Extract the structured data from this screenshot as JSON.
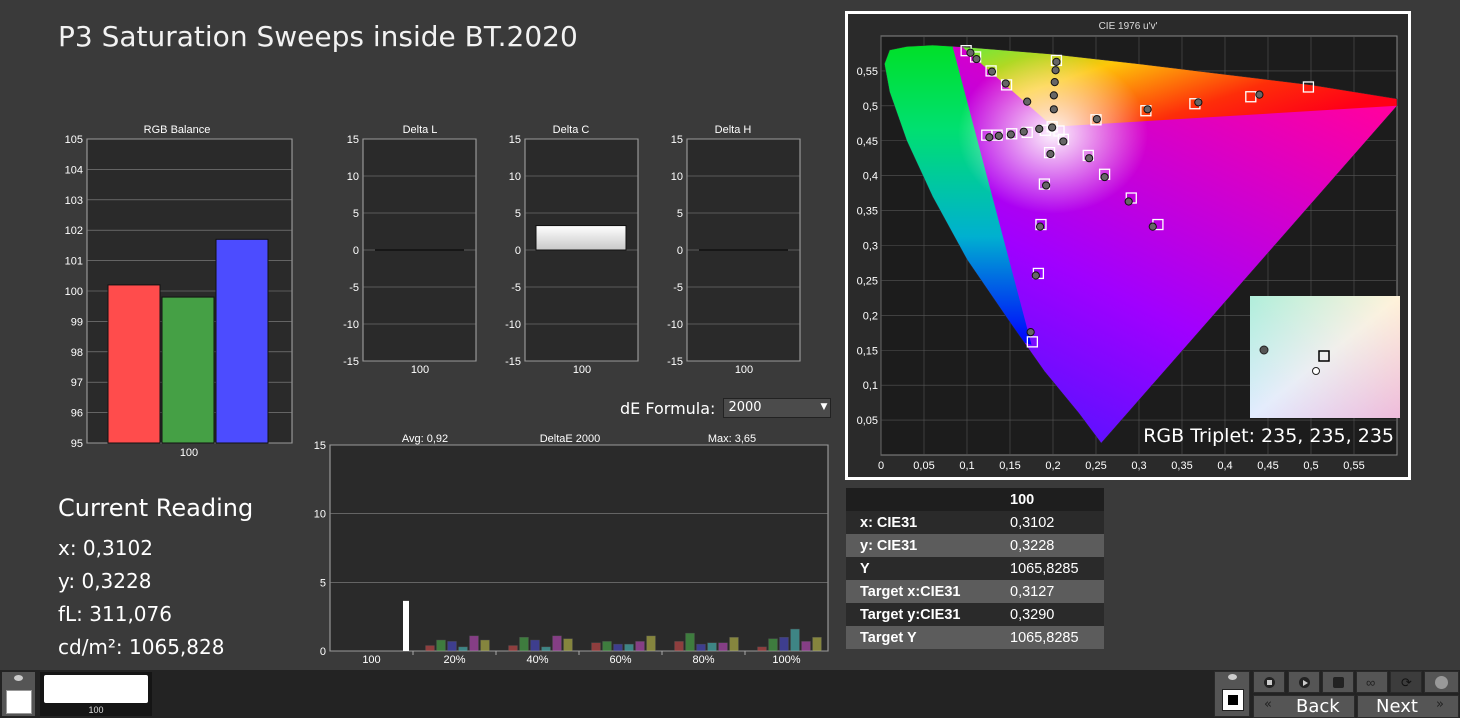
{
  "title": "P3 Saturation Sweeps inside BT.2020",
  "current_reading": {
    "heading": "Current Reading",
    "x": "x: 0,3102",
    "y": "y: 0,3228",
    "fl": "fL: 311,076",
    "cdm2": "cd/m²: 1065,828"
  },
  "formula": {
    "label": "dE Formula:",
    "value": "2000"
  },
  "rgb_triplet": "RGB Triplet: 235, 235, 235",
  "table": {
    "header": "100",
    "rows": [
      {
        "label": "x: CIE31",
        "value": "0,3102"
      },
      {
        "label": "y: CIE31",
        "value": "0,3228"
      },
      {
        "label": "Y",
        "value": "1065,8285"
      },
      {
        "label": "Target x:CIE31",
        "value": "0,3127"
      },
      {
        "label": "Target y:CIE31",
        "value": "0,3290"
      },
      {
        "label": "Target Y",
        "value": "1065,8285"
      }
    ]
  },
  "thumbnail_label": "100",
  "nav": {
    "back": "Back",
    "next": "Next"
  },
  "chart_data": [
    {
      "type": "bar",
      "title": "RGB Balance",
      "categories": [
        "100"
      ],
      "series": [
        {
          "color": "#ff4c4c",
          "values": [
            100.2
          ]
        },
        {
          "color": "#45a045",
          "values": [
            99.8
          ]
        },
        {
          "color": "#4c4cff",
          "values": [
            101.7
          ]
        }
      ],
      "ylim": [
        95,
        105
      ],
      "yticks": [
        "105",
        "104",
        "103",
        "102",
        "101",
        "100",
        "99",
        "98",
        "97",
        "96",
        "95"
      ],
      "grid": true
    },
    {
      "type": "bar",
      "title": "Delta L",
      "categories": [
        "100"
      ],
      "values": [
        0
      ],
      "ylim": [
        -15,
        15
      ],
      "yticks": [
        "15",
        "10",
        "5",
        "0",
        "-5",
        "-10",
        "-15"
      ]
    },
    {
      "type": "bar",
      "title": "Delta C",
      "categories": [
        "100"
      ],
      "values": [
        3.3
      ],
      "ylim": [
        -15,
        15
      ],
      "yticks": [
        "15",
        "10",
        "5",
        "0",
        "-5",
        "-10",
        "-15"
      ]
    },
    {
      "type": "bar",
      "title": "Delta H",
      "categories": [
        "100"
      ],
      "values": [
        0
      ],
      "ylim": [
        -15,
        15
      ],
      "yticks": [
        "15",
        "10",
        "5",
        "0",
        "-5",
        "-10",
        "-15"
      ]
    },
    {
      "type": "bar",
      "title": "DeltaE 2000",
      "avg_label": "Avg: 0,92",
      "max_label": "Max: 3,65",
      "categories": [
        "100",
        "20%",
        "40%",
        "60%",
        "80%",
        "100%"
      ],
      "series_colors": [
        "#e05050",
        "#50c050",
        "#5050e0",
        "#50d0d0",
        "#d050d0",
        "#d0d050"
      ],
      "groups": [
        [
          3.65
        ],
        [
          0.4,
          0.8,
          0.7,
          0.3,
          1.1,
          0.8
        ],
        [
          0.4,
          1.0,
          0.8,
          0.3,
          1.1,
          0.9
        ],
        [
          0.6,
          0.7,
          0.5,
          0.5,
          0.7,
          1.1
        ],
        [
          0.7,
          1.3,
          0.5,
          0.6,
          0.6,
          1.0
        ],
        [
          0.3,
          0.9,
          1.0,
          1.6,
          0.7,
          1.0
        ]
      ],
      "ylim": [
        0,
        15
      ],
      "yticks": [
        "15",
        "10",
        "5",
        "0"
      ]
    },
    {
      "type": "scatter",
      "title": "CIE 1976 u'v'",
      "xlim": [
        0,
        0.6
      ],
      "ylim": [
        0,
        0.6
      ],
      "xticks": [
        "0",
        "0,05",
        "0,1",
        "0,15",
        "0,2",
        "0,25",
        "0,3",
        "0,35",
        "0,4",
        "0,45",
        "0,5",
        "0,55"
      ],
      "yticks": [
        "0,55",
        "0,5",
        "0,45",
        "0,4",
        "0,35",
        "0,3",
        "0,25",
        "0,2",
        "0,15",
        "0,1",
        "0,05"
      ],
      "targets": [
        [
          0.099,
          0.579
        ],
        [
          0.11,
          0.57
        ],
        [
          0.128,
          0.55
        ],
        [
          0.146,
          0.53
        ],
        [
          0.204,
          0.565
        ],
        [
          0.123,
          0.458
        ],
        [
          0.135,
          0.458
        ],
        [
          0.152,
          0.46
        ],
        [
          0.17,
          0.462
        ],
        [
          0.191,
          0.465
        ],
        [
          0.207,
          0.464
        ],
        [
          0.212,
          0.452
        ],
        [
          0.196,
          0.433
        ],
        [
          0.19,
          0.388
        ],
        [
          0.186,
          0.33
        ],
        [
          0.183,
          0.26
        ],
        [
          0.176,
          0.162
        ],
        [
          0.241,
          0.429
        ],
        [
          0.26,
          0.402
        ],
        [
          0.291,
          0.368
        ],
        [
          0.322,
          0.33
        ],
        [
          0.25,
          0.48
        ],
        [
          0.308,
          0.493
        ],
        [
          0.365,
          0.503
        ],
        [
          0.43,
          0.513
        ],
        [
          0.497,
          0.527
        ],
        [
          0.199,
          0.47
        ]
      ],
      "measured": [
        [
          0.104,
          0.576
        ],
        [
          0.111,
          0.567
        ],
        [
          0.129,
          0.549
        ],
        [
          0.145,
          0.532
        ],
        [
          0.17,
          0.506
        ],
        [
          0.204,
          0.563
        ],
        [
          0.203,
          0.551
        ],
        [
          0.202,
          0.534
        ],
        [
          0.201,
          0.515
        ],
        [
          0.201,
          0.495
        ],
        [
          0.126,
          0.455
        ],
        [
          0.137,
          0.457
        ],
        [
          0.151,
          0.459
        ],
        [
          0.166,
          0.463
        ],
        [
          0.184,
          0.467
        ],
        [
          0.199,
          0.469
        ],
        [
          0.212,
          0.449
        ],
        [
          0.197,
          0.431
        ],
        [
          0.192,
          0.386
        ],
        [
          0.185,
          0.327
        ],
        [
          0.18,
          0.257
        ],
        [
          0.174,
          0.176
        ],
        [
          0.242,
          0.425
        ],
        [
          0.26,
          0.398
        ],
        [
          0.288,
          0.363
        ],
        [
          0.316,
          0.327
        ],
        [
          0.251,
          0.481
        ],
        [
          0.31,
          0.495
        ],
        [
          0.369,
          0.505
        ],
        [
          0.44,
          0.516
        ]
      ]
    }
  ]
}
